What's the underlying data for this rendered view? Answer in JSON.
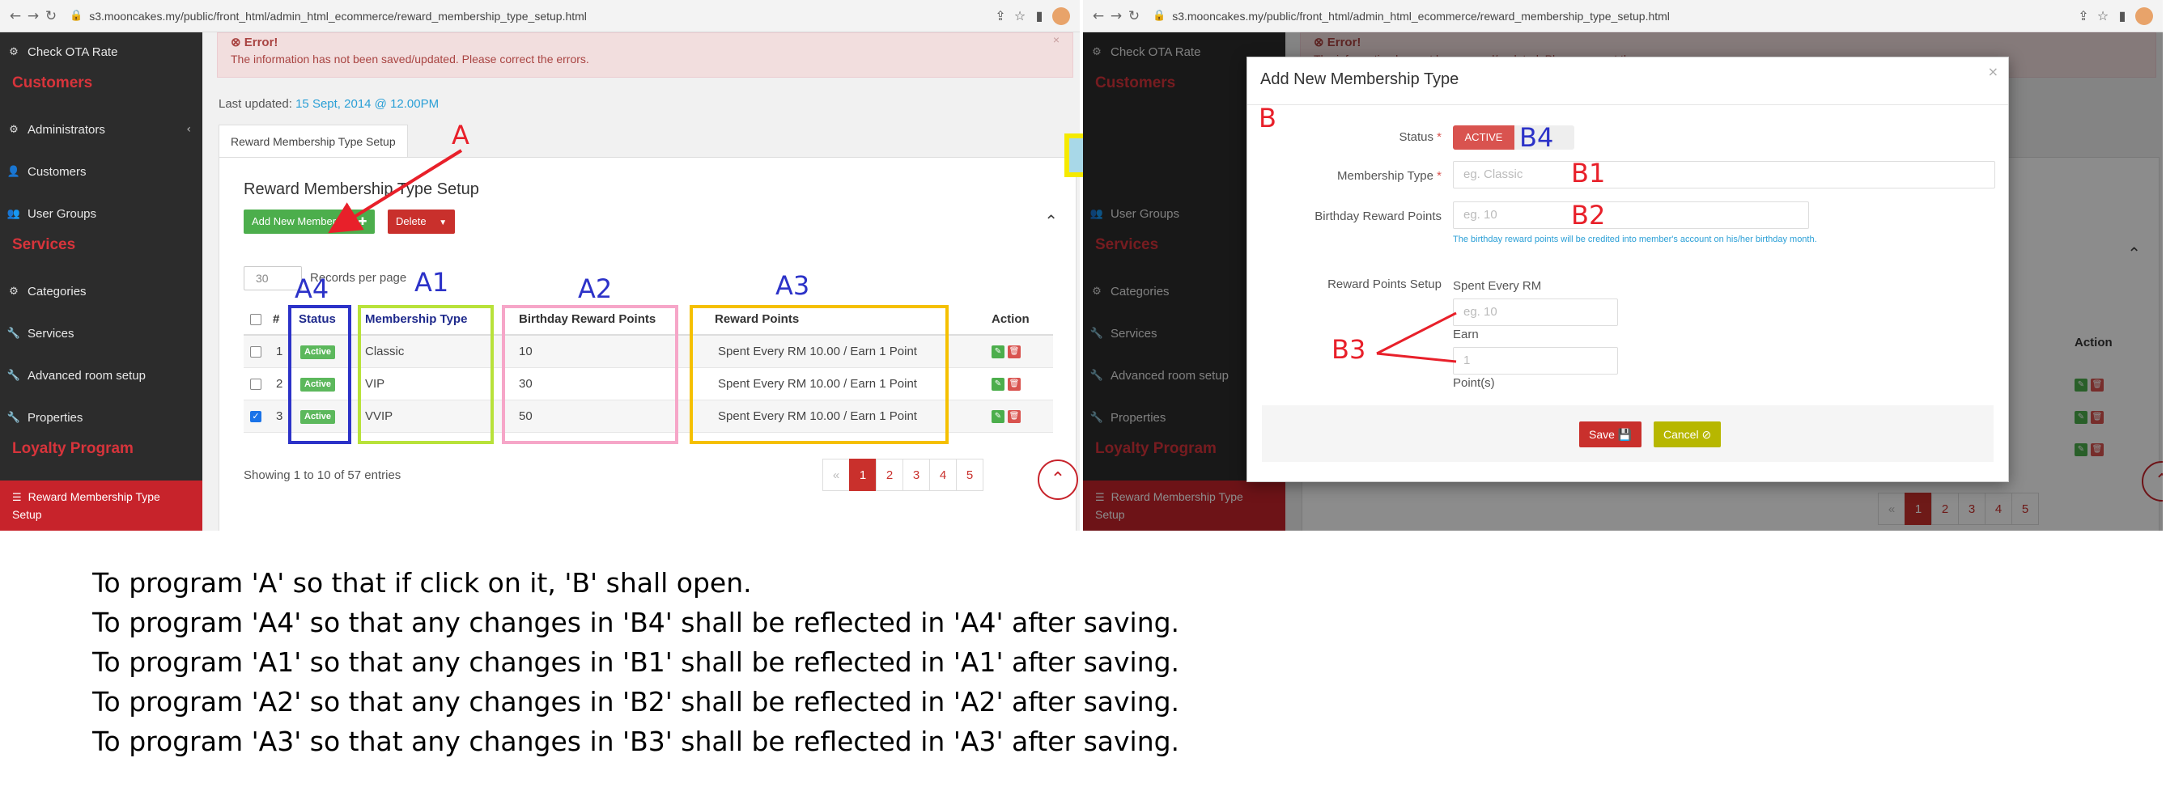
{
  "browser": {
    "url": "s3.mooncakes.my/public/front_html/admin_html_ecommerce/reward_membership_type_setup.html"
  },
  "sidebar": {
    "top_item": "Check OTA Rate",
    "sections": {
      "customers": "Customers",
      "services": "Services",
      "loyalty": "Loyalty Program"
    },
    "items": {
      "administrators": "Administrators",
      "customers": "Customers",
      "user_groups": "User Groups",
      "categories": "Categories",
      "services": "Services",
      "advanced_room_setup": "Advanced room setup",
      "properties": "Properties"
    },
    "active_item": {
      "line1": "Reward Membership Type",
      "line2": "Setup"
    }
  },
  "error": {
    "title": "Error!",
    "message": "The information has not been saved/updated. Please correct the errors."
  },
  "last_updated": {
    "label": "Last updated:",
    "value": "15 Sept, 2014 @ 12.00PM"
  },
  "tab_label": "Reward Membership Type Setup",
  "card": {
    "title": "Reward Membership Type Setup",
    "add_button": "Add New Membership",
    "delete_button": "Delete"
  },
  "records": {
    "per_page_value": "30",
    "per_page_label": "Records per page"
  },
  "table": {
    "headers": {
      "num": "#",
      "status": "Status",
      "type": "Membership Type",
      "birthday": "Birthday Reward Points",
      "reward": "Reward Points",
      "action": "Action"
    },
    "rows": [
      {
        "num": "1",
        "status": "Active",
        "type": "Classic",
        "birthday": "10",
        "reward": "Spent Every RM 10.00 / Earn 1 Point",
        "checked": false
      },
      {
        "num": "2",
        "status": "Active",
        "type": "VIP",
        "birthday": "30",
        "reward": "Spent Every RM 10.00 / Earn 1 Point",
        "checked": false
      },
      {
        "num": "3",
        "status": "Active",
        "type": "VVIP",
        "birthday": "50",
        "reward": "Spent Every RM 10.00 / Earn 1 Point",
        "checked": true
      }
    ]
  },
  "footer": {
    "showing": "Showing 1 to 10 of 57 entries",
    "pages": [
      "«",
      "1",
      "2",
      "3",
      "4",
      "5"
    ],
    "active_page": "1"
  },
  "annotations": {
    "A": "A",
    "A1": "A1",
    "A2": "A2",
    "A3": "A3",
    "A4": "A4",
    "B": "B",
    "B1": "B1",
    "B2": "B2",
    "B3": "B3",
    "B4": "B4",
    "colors": {
      "red": "#e8202a",
      "blue": "#2c32c8",
      "green": "#b8e23a",
      "pink": "#f6a6c8",
      "yellow": "#f5c000",
      "arrow_fill": "#a8d8e8",
      "arrow_stroke": "#f5ea00"
    }
  },
  "modal": {
    "title": "Add New Membership Type",
    "status_label": "Status",
    "required_mark": "*",
    "status_toggle": "ACTIVE",
    "type_label": "Membership Type",
    "type_placeholder": "eg. Classic",
    "birthday_label": "Birthday Reward Points",
    "birthday_placeholder": "eg. 10",
    "birthday_help": "The birthday reward points will be credited into member's account on his/her birthday month.",
    "reward_label": "Reward Points Setup",
    "spent_label": "Spent Every RM",
    "spent_placeholder": "eg. 10",
    "earn_label": "Earn",
    "earn_placeholder": "1",
    "points_label": "Point(s)",
    "save": "Save",
    "cancel": "Cancel"
  },
  "right_panel_background": {
    "error_title": "Error!",
    "error_message": "The information has not been saved/updated. Please correct the errors.",
    "action_header": "Action"
  },
  "instructions": [
    "To program 'A' so that if click on it, 'B' shall open.",
    "To program 'A4' so that any changes in 'B4' shall be reflected in 'A4' after saving.",
    "To program 'A1' so that any changes in 'B1' shall be reflected in 'A1' after saving.",
    "To program 'A2' so that any changes in 'B2' shall be reflected in 'A2' after saving.",
    "To program 'A3' so that any changes in 'B3' shall be reflected in 'A3' after saving."
  ]
}
